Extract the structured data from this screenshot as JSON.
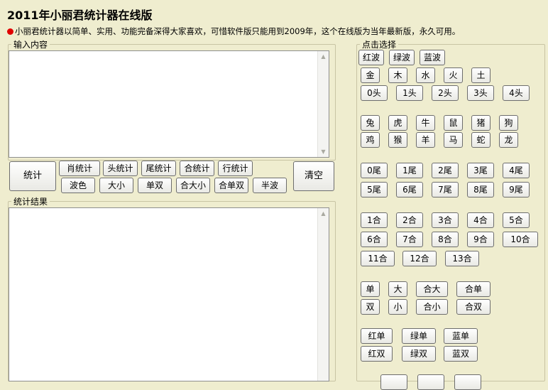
{
  "title": "2011年小丽君统计器在线版",
  "intro": "小丽君统计器以简单、实用、功能完备深得大家喜欢，可惜软件版只能用到2009年，这个在线版为当年最新版，永久可用。",
  "input_legend": "输入内容",
  "result_legend": "统计结果",
  "pick_legend": "点击选择",
  "buttons": {
    "stat": "统计",
    "clear": "清空",
    "row1": [
      "肖统计",
      "头统计",
      "尾统计",
      "合统计",
      "行统计"
    ],
    "row2": [
      "波色",
      "大小",
      "单双",
      "合大小",
      "合单双",
      "半波"
    ]
  },
  "pick": {
    "waves": [
      "红波",
      "绿波",
      "蓝波"
    ],
    "elements": [
      "金",
      "木",
      "水",
      "火",
      "土"
    ],
    "heads": [
      "0头",
      "1头",
      "2头",
      "3头",
      "4头"
    ],
    "zodiac1": [
      "兔",
      "虎",
      "牛",
      "鼠",
      "猪",
      "狗"
    ],
    "zodiac2": [
      "鸡",
      "猴",
      "羊",
      "马",
      "蛇",
      "龙"
    ],
    "tails1": [
      "0尾",
      "1尾",
      "2尾",
      "3尾",
      "4尾"
    ],
    "tails2": [
      "5尾",
      "6尾",
      "7尾",
      "8尾",
      "9尾"
    ],
    "sums1": [
      "1合",
      "2合",
      "3合",
      "4合",
      "5合"
    ],
    "sums2": [
      "6合",
      "7合",
      "8合",
      "9合",
      "10合"
    ],
    "sums3": [
      "11合",
      "12合",
      "13合"
    ],
    "oe1": [
      "单",
      "大",
      "合大",
      "合单"
    ],
    "oe2": [
      "双",
      "小",
      "合小",
      "合双"
    ],
    "color1": [
      "红单",
      "绿单",
      "蓝单"
    ],
    "color2": [
      "红双",
      "绿双",
      "蓝双"
    ]
  }
}
